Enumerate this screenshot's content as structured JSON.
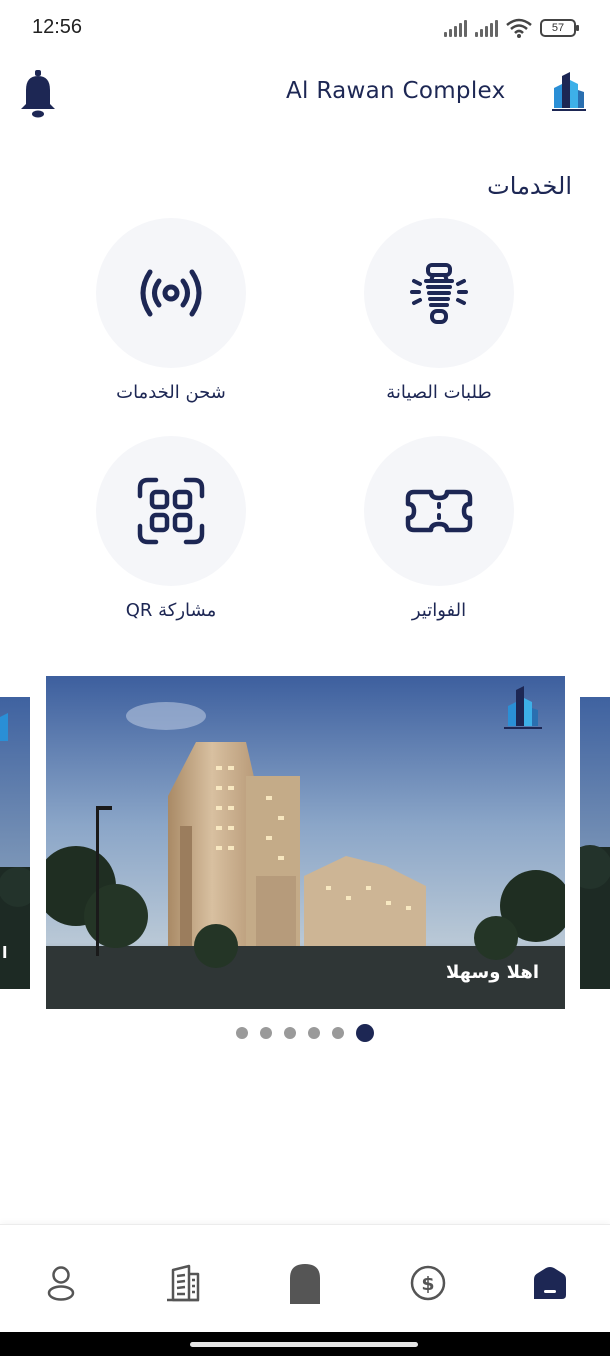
{
  "status_bar": {
    "time": "12:56",
    "battery": "57"
  },
  "header": {
    "title": "Al Rawan Complex",
    "bell_icon": "bell-icon",
    "logo_icon": "alrawan-logo"
  },
  "services": {
    "title": "الخدمات",
    "items": [
      {
        "label": "طلبات الصيانة",
        "icon": "maintenance-bulb-icon"
      },
      {
        "label": "شحن الخدمات",
        "icon": "broadcast-icon"
      },
      {
        "label": "الفواتير",
        "icon": "ticket-icon"
      },
      {
        "label": "مشاركة QR",
        "icon": "qr-grid-icon"
      }
    ]
  },
  "carousel": {
    "caption": "اهلا وسهلا",
    "side_caption": "ا",
    "slide_count": 6,
    "active_index": 5
  },
  "bottom_nav": {
    "items": [
      {
        "icon": "profile-icon"
      },
      {
        "icon": "document-icon"
      },
      {
        "icon": "door-icon"
      },
      {
        "icon": "dollar-icon"
      },
      {
        "icon": "home-icon"
      }
    ],
    "active_index": 4
  },
  "colors": {
    "primary": "#1d2754",
    "tile_background": "#f5f6f9",
    "inactive_icon": "#555555"
  }
}
